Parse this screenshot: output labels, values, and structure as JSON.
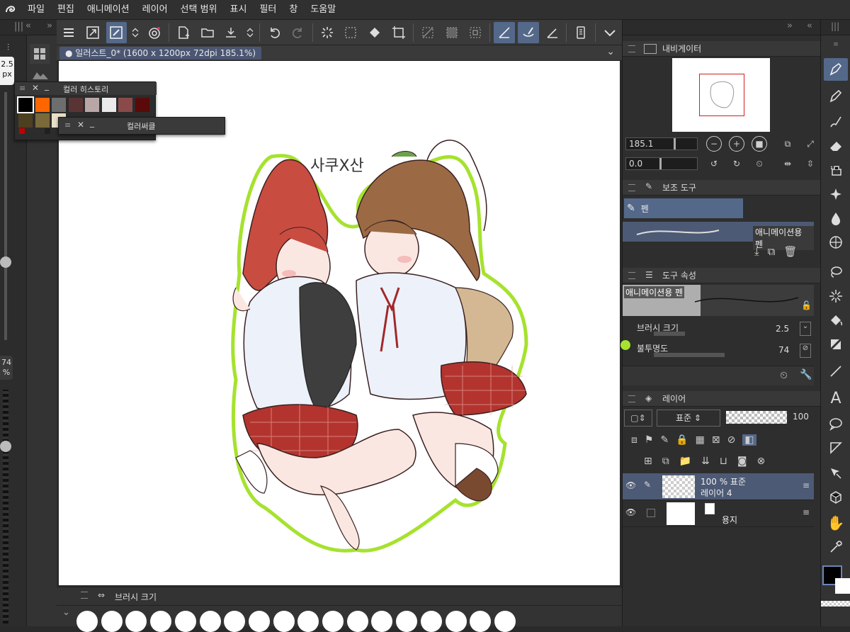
{
  "menu": [
    "파일",
    "편집",
    "애니메이션",
    "레이어",
    "선택 범위",
    "표시",
    "필터",
    "창",
    "도움말"
  ],
  "document_tab": "일러스트_0* (1600 x 1200px 72dpi 185.1%)",
  "left": {
    "brush_size": "2.5",
    "brush_unit": "px",
    "opacity": "74",
    "opacity_unit": "%"
  },
  "color_history": {
    "title": "컬러 히스토리",
    "swatches": [
      "#000000",
      "#ff6600",
      "#6e6e6e",
      "#5a3434",
      "#b9a7a7",
      "#eaeaea",
      "#8a4a4a",
      "#5a0a0a",
      "#4d4020",
      "#7a6a3a",
      "#e8e0c8"
    ],
    "small": [
      "#c00000",
      "#202020",
      "#00a000"
    ]
  },
  "color_circle": {
    "title": "컬러써클"
  },
  "navigator": {
    "title": "내비게이터",
    "zoom": "185.1",
    "rotation": "0.0"
  },
  "sub_tool": {
    "title": "보조 도구",
    "group": "펜",
    "item": "애니메이션용 펜"
  },
  "tool_property": {
    "title": "도구 속성",
    "preset": "애니메이션용 펜",
    "brush_size_label": "브러시 크기",
    "brush_size_value": "2.5",
    "opacity_label": "불투명도",
    "opacity_value": "74"
  },
  "layer": {
    "title": "레이어",
    "blend": "표준",
    "opacity": "100",
    "rows": [
      {
        "line1": "100 % 표준",
        "line2": "레이어 4"
      },
      {
        "line1": "",
        "line2": "용지"
      }
    ]
  },
  "brush_size_palette": {
    "title": "브러시 크기"
  },
  "illustration": {
    "text": "사쿠X산"
  },
  "colors": {
    "accent": "#54688a",
    "lime": "#a6e22e",
    "panel": "#2e2e2e"
  }
}
